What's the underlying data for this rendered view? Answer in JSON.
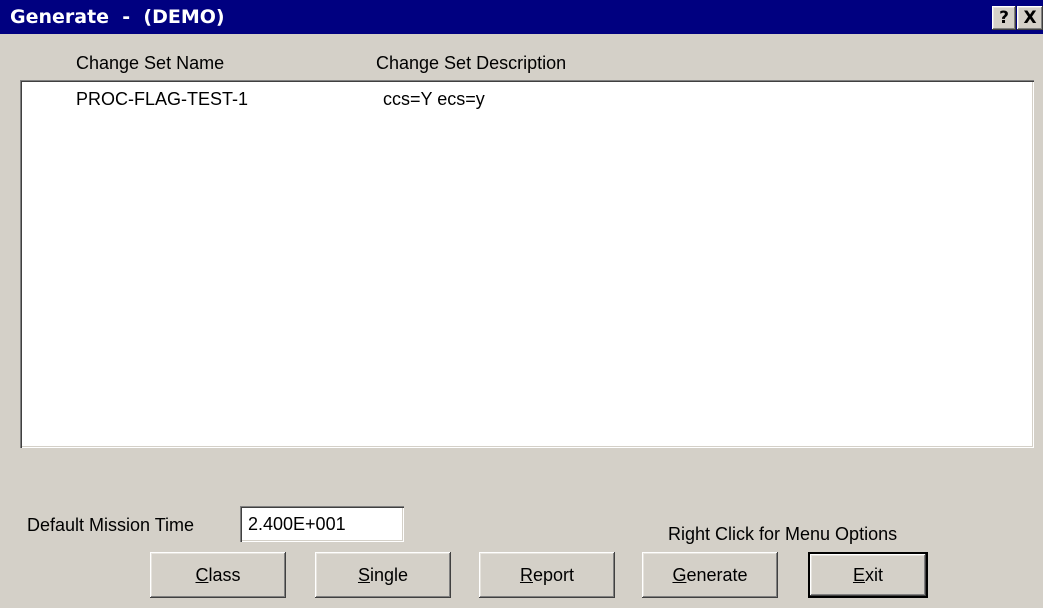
{
  "window": {
    "title": "Generate  -  (DEMO)",
    "help_icon": "?",
    "close_icon": "X"
  },
  "list": {
    "columns": [
      "Change Set Name",
      "Change Set Description"
    ],
    "rows": [
      {
        "name": "PROC-FLAG-TEST-1",
        "description": "ccs=Y ecs=y"
      }
    ]
  },
  "mission": {
    "label": "Default Mission Time",
    "value": "2.400E+001"
  },
  "hint": "Right Click for Menu Options",
  "buttons": {
    "class": {
      "mnemonic": "C",
      "rest": "lass"
    },
    "single": {
      "mnemonic": "S",
      "rest": "ingle"
    },
    "report": {
      "mnemonic": "R",
      "rest": "eport"
    },
    "generate": {
      "mnemonic": "G",
      "rest": "enerate"
    },
    "exit": {
      "mnemonic": "E",
      "rest": "xit"
    }
  },
  "colors": {
    "titlebar": "#000080",
    "face": "#d4d0c8",
    "list_bg": "#ffffff"
  }
}
